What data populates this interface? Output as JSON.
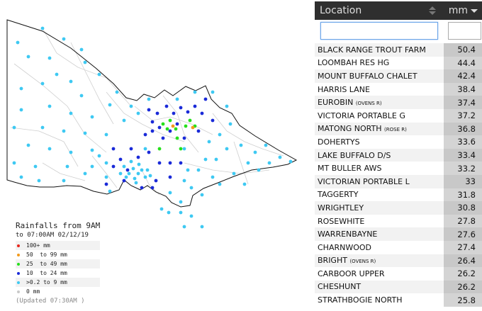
{
  "legend": {
    "title": "Rainfalls from 9AM",
    "subtitle": "to 07:00AM 02/12/19",
    "items": [
      {
        "label": "100+ mm",
        "color": "#e8261c"
      },
      {
        "label": "50  to 99 mm",
        "color": "#f39a1c"
      },
      {
        "label": "25  to 49 mm",
        "color": "#26e01c"
      },
      {
        "label": "10  to 24 mm",
        "color": "#1a2ad8"
      },
      {
        "label": ">0.2 to 9 mm",
        "color": "#3ec9f2"
      },
      {
        "label": "0 mm",
        "color": "#c9c9c9"
      }
    ],
    "updated": "(Updated 07:30AM  )"
  },
  "panel": {
    "location_header": "Location",
    "mm_header": "mm",
    "location_filter_placeholder": "",
    "mm_filter_placeholder": ""
  },
  "stations": [
    {
      "name": "BLACK RANGE TROUT FARM",
      "river": "",
      "mm": "50.4"
    },
    {
      "name": "LOOMBAH RES HG",
      "river": "",
      "mm": "44.4"
    },
    {
      "name": "MOUNT BUFFALO CHALET",
      "river": "",
      "mm": "42.4"
    },
    {
      "name": "HARRIS LANE",
      "river": "",
      "mm": "38.4"
    },
    {
      "name": "EUROBIN",
      "river": "(OVENS R)",
      "mm": "37.4"
    },
    {
      "name": "VICTORIA PORTABLE G",
      "river": "",
      "mm": "37.2"
    },
    {
      "name": "MATONG NORTH",
      "river": "(ROSE R)",
      "mm": "36.8"
    },
    {
      "name": "DOHERTYS",
      "river": "",
      "mm": "33.6"
    },
    {
      "name": "LAKE BUFFALO D/S",
      "river": "",
      "mm": "33.4"
    },
    {
      "name": "MT BULLER AWS",
      "river": "",
      "mm": "33.2"
    },
    {
      "name": "VICTORIAN PORTABLE L",
      "river": "",
      "mm": "33"
    },
    {
      "name": "TAGGERTY",
      "river": "",
      "mm": "31.8"
    },
    {
      "name": "WRIGHTLEY",
      "river": "",
      "mm": "30.8"
    },
    {
      "name": "ROSEWHITE",
      "river": "",
      "mm": "27.8"
    },
    {
      "name": "WARRENBAYNE",
      "river": "",
      "mm": "27.6"
    },
    {
      "name": "CHARNWOOD",
      "river": "",
      "mm": "27.4"
    },
    {
      "name": "BRIGHT",
      "river": "(OVENS R)",
      "mm": "26.4"
    },
    {
      "name": "CARBOOR UPPER",
      "river": "",
      "mm": "26.2"
    },
    {
      "name": "CHESHUNT",
      "river": "",
      "mm": "26.2"
    },
    {
      "name": "STRATHBOGIE NORTH",
      "river": "",
      "mm": "25.8"
    }
  ]
}
